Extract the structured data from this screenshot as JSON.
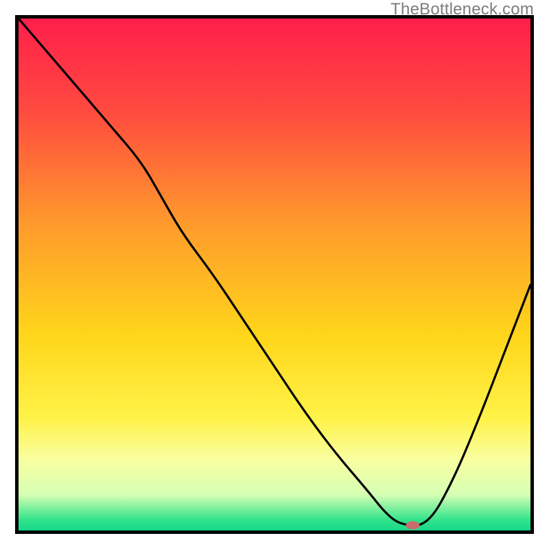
{
  "watermark": "TheBottleneck.com",
  "chart_data": {
    "type": "line",
    "title": "",
    "xlabel": "",
    "ylabel": "",
    "xlim": [
      0,
      100
    ],
    "ylim": [
      0,
      100
    ],
    "grid": false,
    "gradient_stops": [
      {
        "t": 0.0,
        "color": "#ff1f4b"
      },
      {
        "t": 0.18,
        "color": "#ff4a3f"
      },
      {
        "t": 0.4,
        "color": "#ff9a2c"
      },
      {
        "t": 0.62,
        "color": "#ffd61a"
      },
      {
        "t": 0.78,
        "color": "#fff248"
      },
      {
        "t": 0.86,
        "color": "#f9ffa0"
      },
      {
        "t": 0.93,
        "color": "#d6ffb4"
      },
      {
        "t": 0.98,
        "color": "#30e38a"
      },
      {
        "t": 1.0,
        "color": "#17d88b"
      }
    ],
    "series": [
      {
        "name": "bottleneck-curve",
        "x": [
          0,
          6,
          12,
          18,
          24,
          28,
          32,
          38,
          44,
          50,
          56,
          62,
          68,
          72,
          75,
          80,
          85,
          90,
          95,
          100
        ],
        "y": [
          100,
          93,
          86,
          79,
          72,
          65,
          58,
          50,
          41,
          32,
          23,
          15,
          8,
          3,
          1,
          1,
          10,
          22,
          35,
          48
        ]
      }
    ],
    "marker": {
      "x": 77,
      "y": 1,
      "color": "#cc6b6b",
      "rx": 10,
      "ry": 6
    }
  }
}
